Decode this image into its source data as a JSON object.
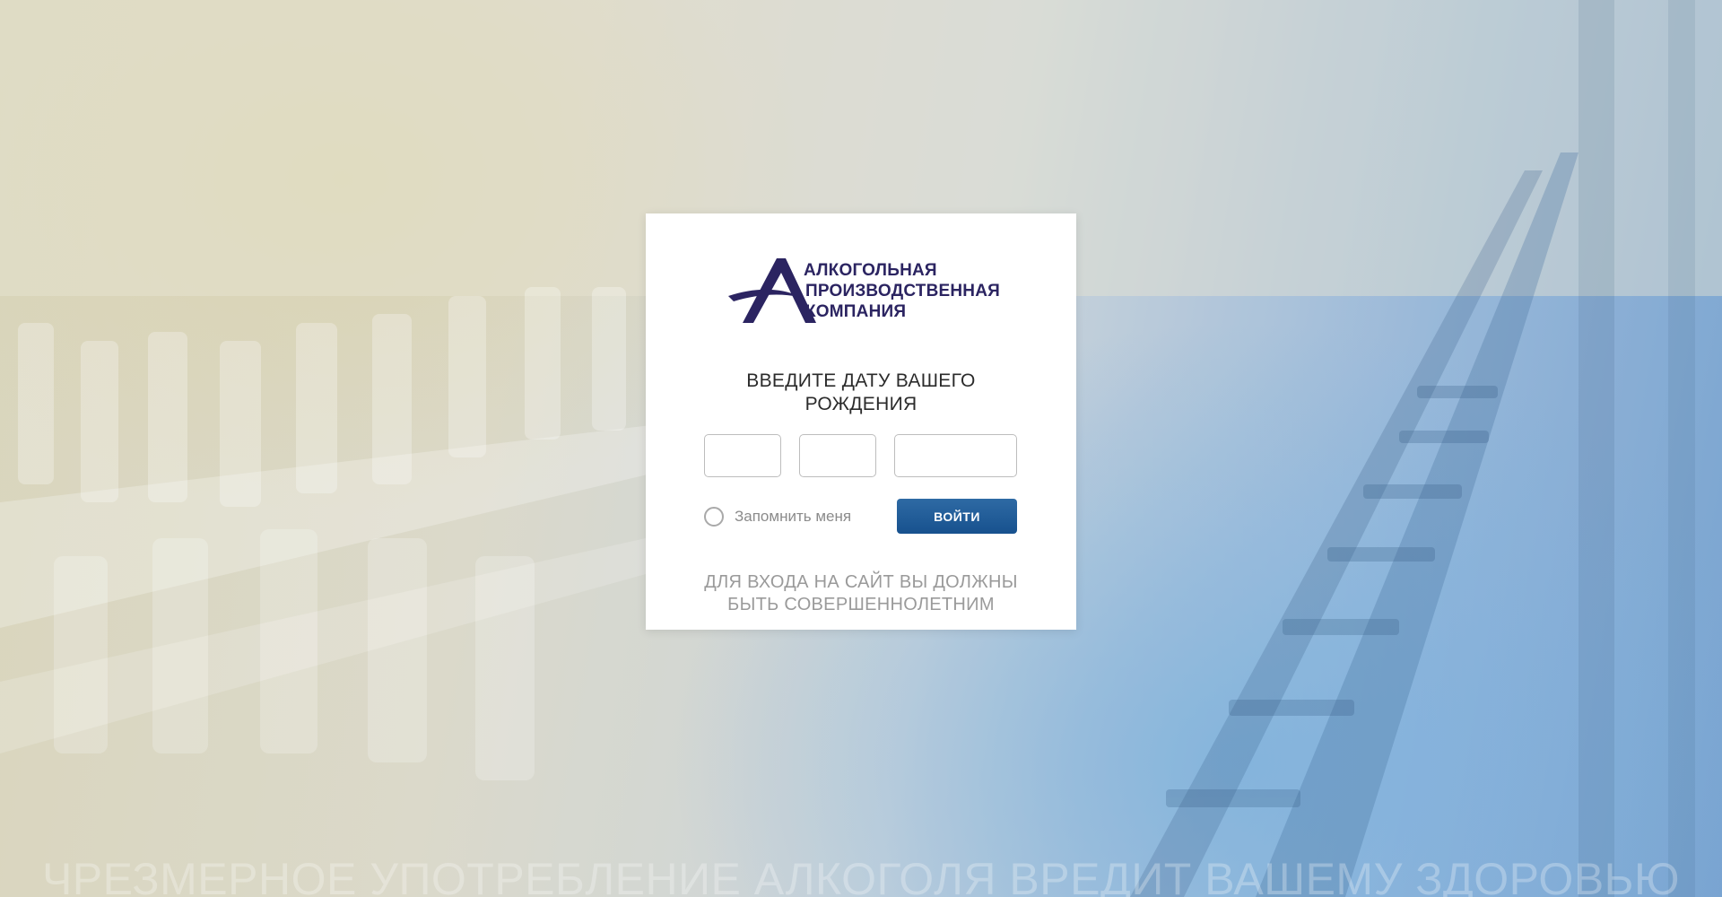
{
  "logo": {
    "line1": "АЛКОГОЛЬНАЯ",
    "line2": "ПРОИЗВОДСТВЕННАЯ",
    "line3": "КОМПАНИЯ",
    "color": "#2b2461"
  },
  "prompt": {
    "line1": "ВВЕДИТЕ ДАТУ ВАШЕГО",
    "line2": "РОЖДЕНИЯ"
  },
  "date_inputs": {
    "day": {
      "value": "",
      "placeholder": ""
    },
    "month": {
      "value": "",
      "placeholder": ""
    },
    "year": {
      "value": "",
      "placeholder": ""
    }
  },
  "remember": {
    "label": "Запомнить меня",
    "checked": false
  },
  "login_button": {
    "label": "ВОЙТИ",
    "color": "#1e5a96"
  },
  "note": {
    "line1": "ДЛЯ ВХОДА НА САЙТ ВЫ ДОЛЖНЫ",
    "line2": "БЫТЬ СОВЕРШЕННОЛЕТНИМ"
  },
  "footer_warning": "ЧРЕЗМЕРНОЕ УПОТРЕБЛЕНИЕ АЛКОГОЛЯ ВРЕДИТ ВАШЕМУ ЗДОРОВЬЮ"
}
